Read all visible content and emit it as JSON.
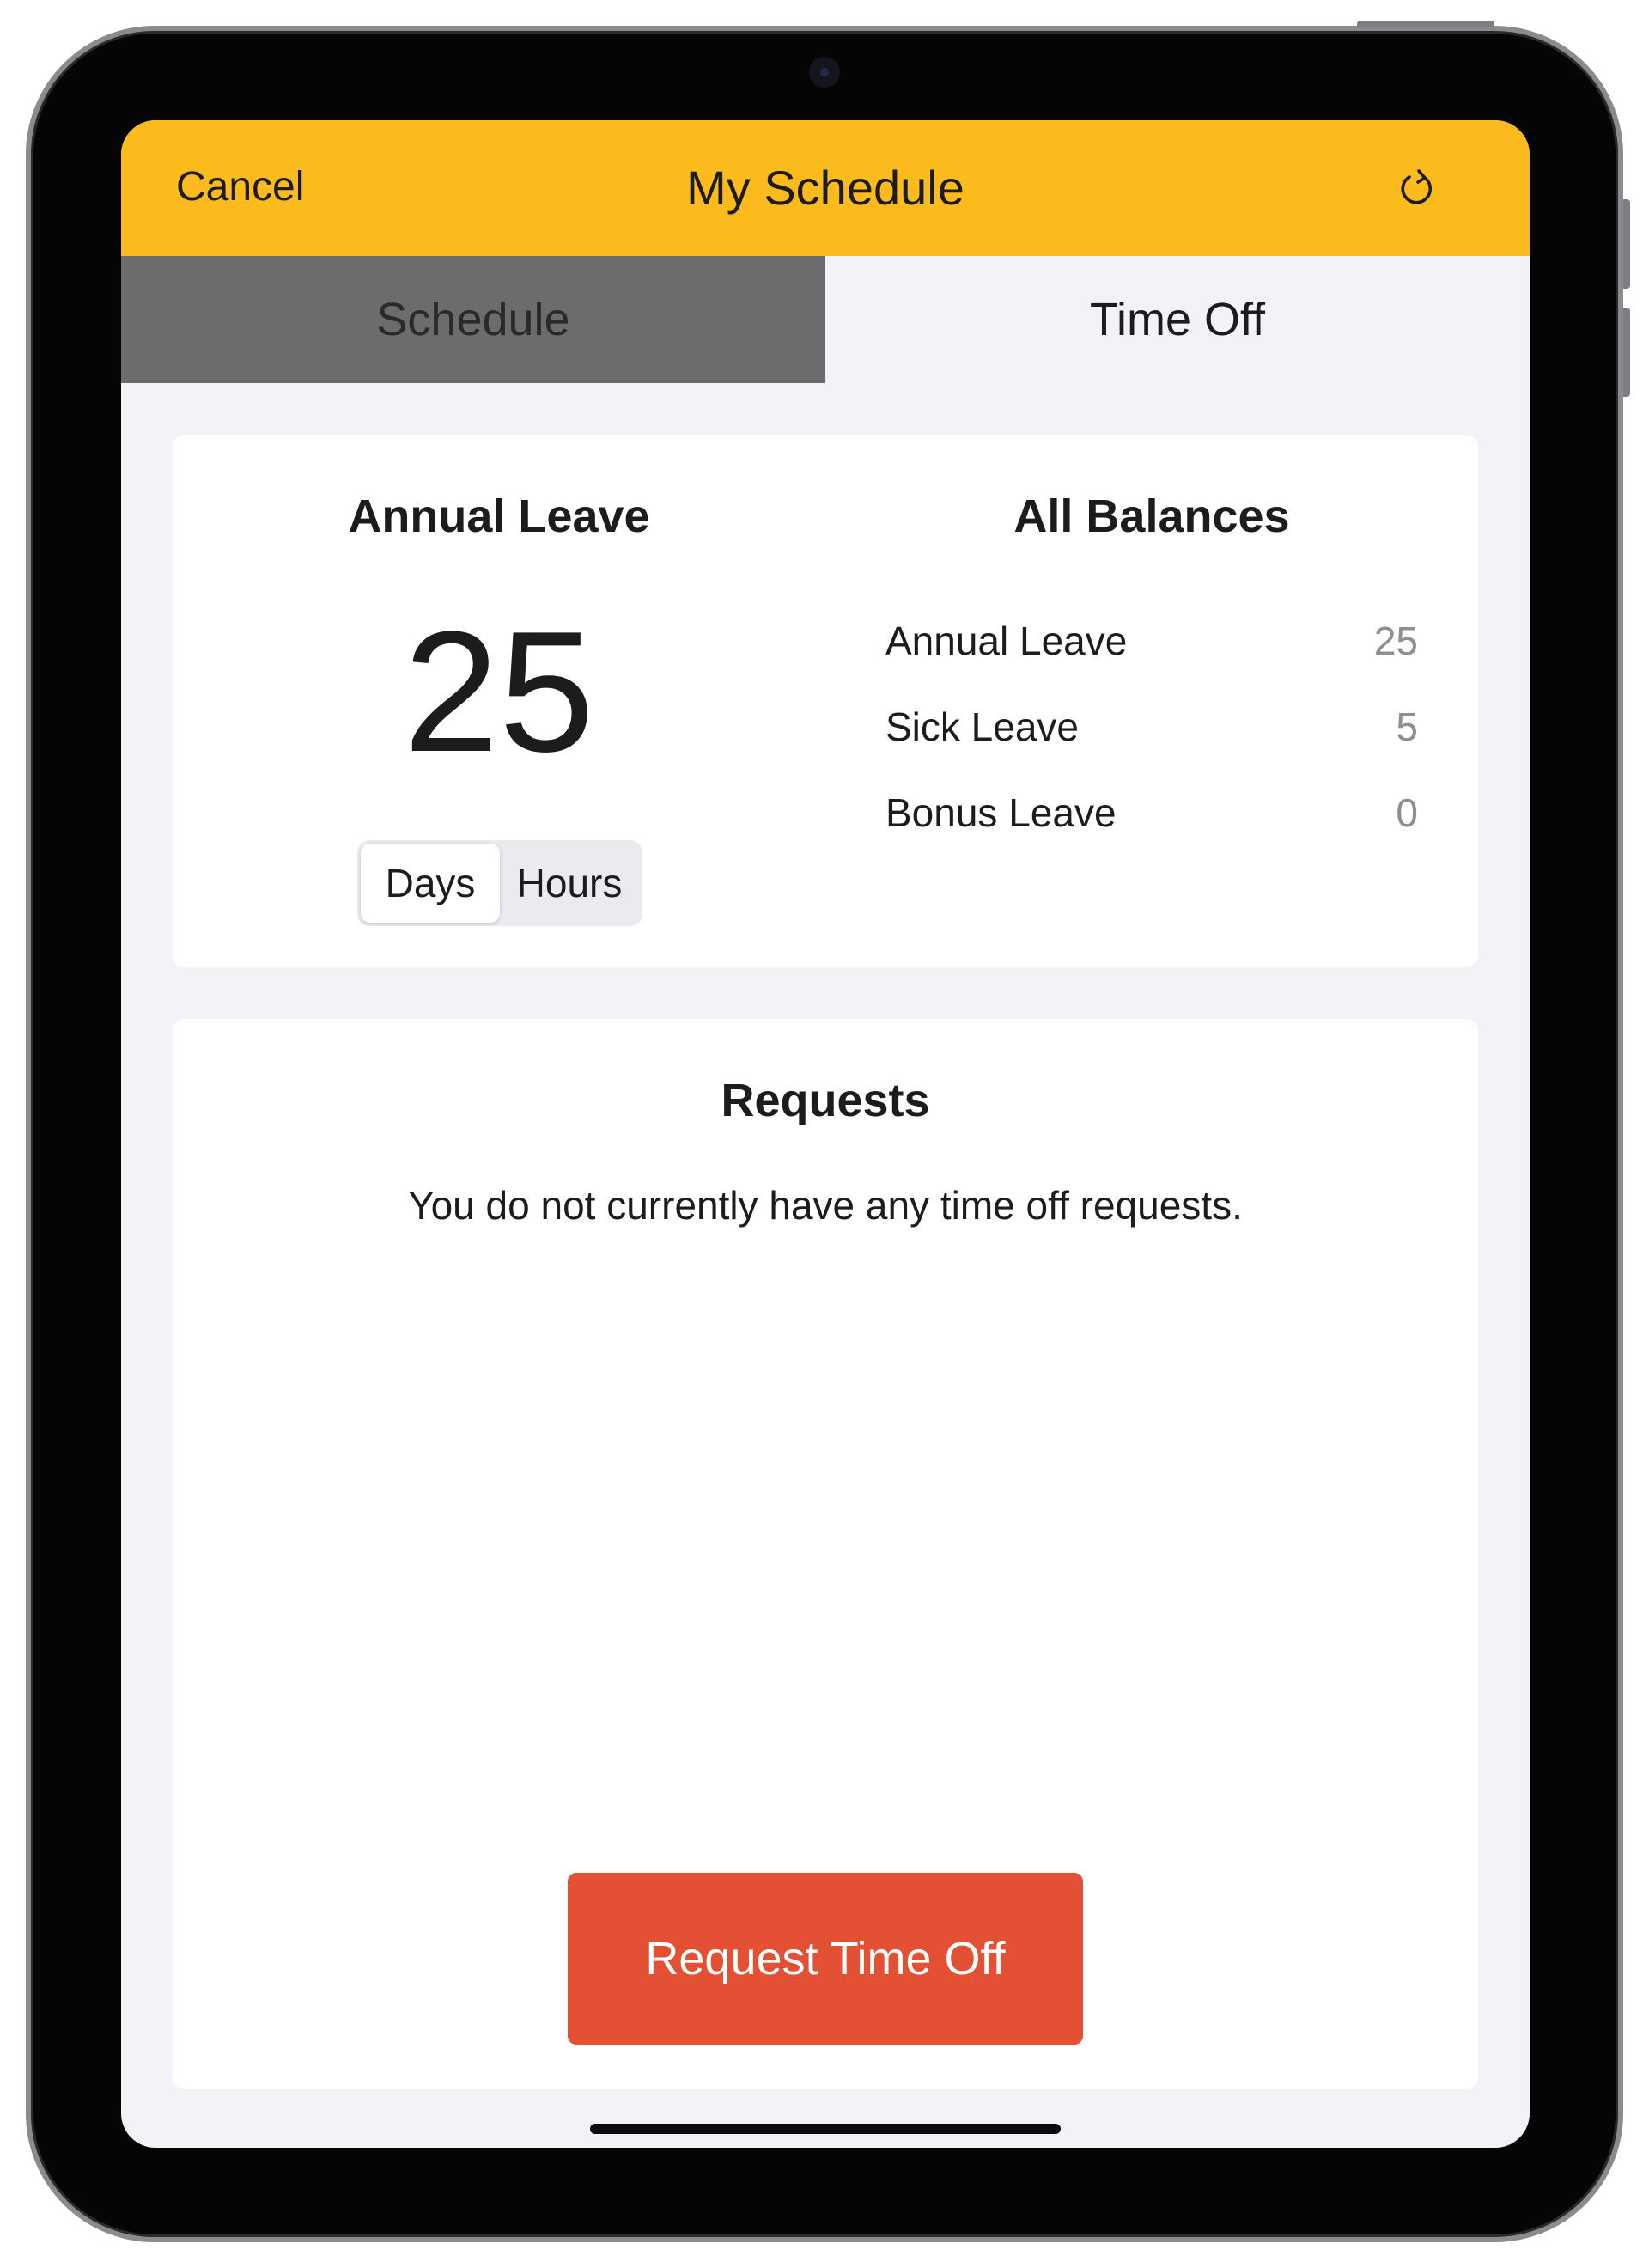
{
  "colors": {
    "nav_background": "#fcbb1c",
    "inactive_segment": "#6c6c6e",
    "active_segment": "#f2f2f7",
    "primary_button": "#e35033",
    "secondary_text": "#8e8e93"
  },
  "navbar": {
    "cancel_label": "Cancel",
    "title": "My Schedule",
    "refresh_icon": "refresh-icon"
  },
  "tabs": [
    {
      "label": "Schedule",
      "selected": false
    },
    {
      "label": "Time Off",
      "selected": true
    }
  ],
  "balance_card": {
    "title": "Annual Leave",
    "value": "25",
    "unit_toggle": [
      {
        "label": "Days",
        "selected": true
      },
      {
        "label": "Hours",
        "selected": false
      }
    ]
  },
  "all_balances": {
    "title": "All Balances",
    "items": [
      {
        "name": "Annual Leave",
        "value": "25"
      },
      {
        "name": "Sick Leave",
        "value": "5"
      },
      {
        "name": "Bonus Leave",
        "value": "0"
      }
    ]
  },
  "requests": {
    "title": "Requests",
    "empty_message": "You do not currently have any time off requests.",
    "button_label": "Request Time Off"
  }
}
